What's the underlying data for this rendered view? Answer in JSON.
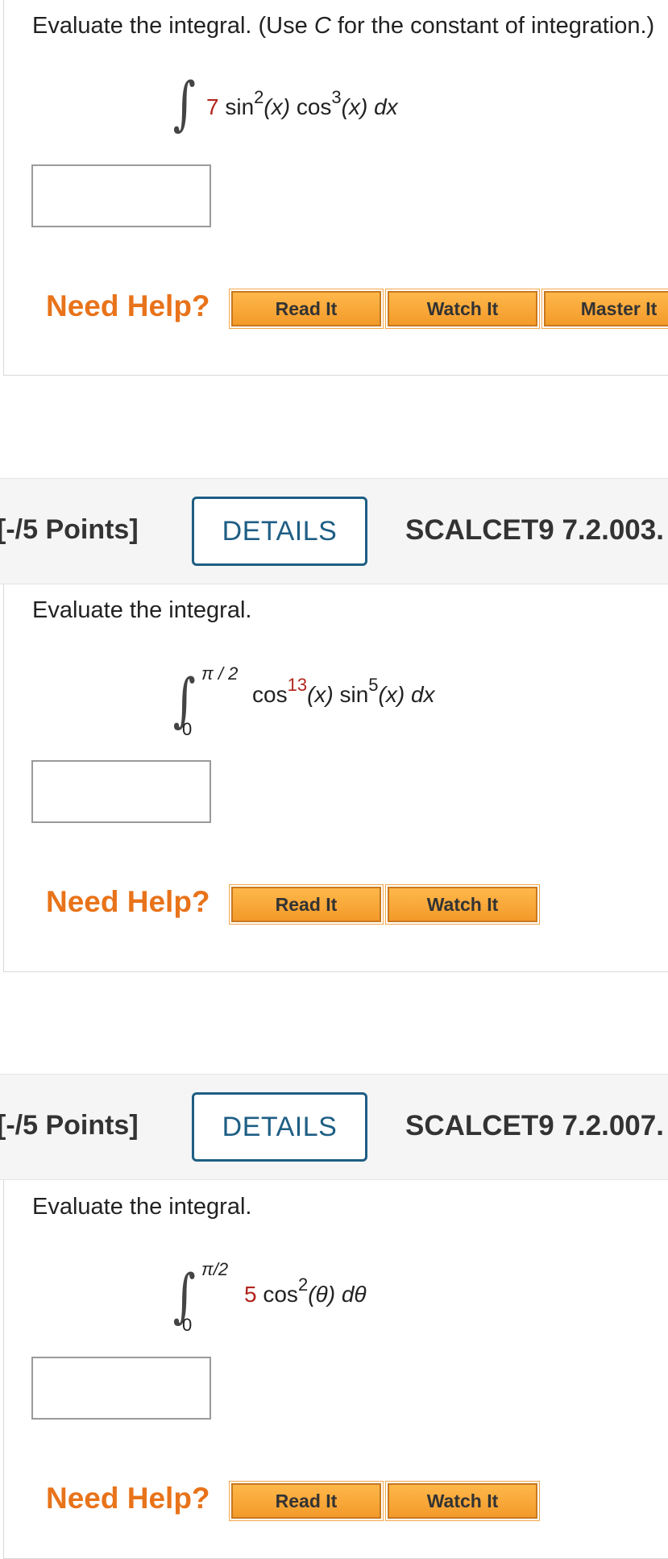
{
  "q1": {
    "prompt_lead": "Evaluate the integral. (Use ",
    "prompt_c": "C",
    "prompt_tail": " for the constant of integration.)",
    "integrand": {
      "coef": "7",
      "f1": "sin",
      "f1_exp": "2",
      "f1_arg": "(x)",
      "f2": "cos",
      "f2_exp": "3",
      "f2_arg": "(x)",
      "d": "dx"
    },
    "need_help": "Need Help?",
    "buttons": [
      "Read It",
      "Watch It",
      "Master It"
    ]
  },
  "q2": {
    "points": "[-/5 Points]",
    "details": "DETAILS",
    "code": "SCALCET9 7.2.003.",
    "prompt": "Evaluate the integral.",
    "upper": "π / 2",
    "lower": "0",
    "integrand": {
      "f1": "cos",
      "f1_exp": "13",
      "f1_arg": "(x)",
      "f2": "sin",
      "f2_exp": "5",
      "f2_arg": "(x)",
      "d": "dx"
    },
    "need_help": "Need Help?",
    "buttons": [
      "Read It",
      "Watch It"
    ]
  },
  "q3": {
    "points": "[-/5 Points]",
    "details": "DETAILS",
    "code": "SCALCET9 7.2.007.",
    "prompt": "Evaluate the integral.",
    "upper": "π/2",
    "lower": "0",
    "integrand": {
      "coef": "5",
      "f1": "cos",
      "f1_exp": "2",
      "f1_arg": "(θ)",
      "d": "dθ"
    },
    "need_help": "Need Help?",
    "buttons": [
      "Read It",
      "Watch It"
    ]
  },
  "colors": {
    "accent_orange": "#e8731a",
    "details_blue": "#1e5e84",
    "coefficient_red": "#b1241c"
  },
  "icons": [
    "integral-sign-icon"
  ]
}
